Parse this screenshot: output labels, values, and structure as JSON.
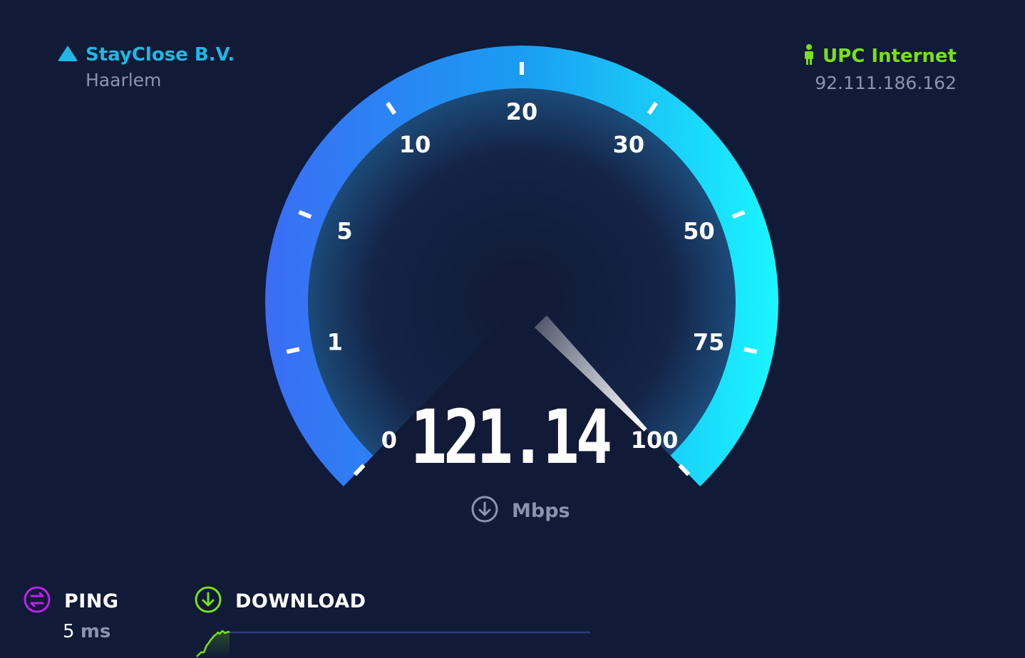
{
  "server": {
    "name": "StayClose B.V.",
    "location": "Haarlem",
    "icon": "triangle-icon",
    "color": "#1fb8e6"
  },
  "isp": {
    "name": "UPC Internet",
    "ip": "92.111.186.162",
    "icon": "person-icon",
    "color": "#7be016"
  },
  "gauge": {
    "value": "121.14",
    "unit": "Mbps",
    "scale_labels": [
      "0",
      "1",
      "5",
      "10",
      "20",
      "30",
      "50",
      "75",
      "100"
    ],
    "needle_fraction": 1.0,
    "gradient_start": "#3a6df5",
    "gradient_end": "#19f2ff"
  },
  "ping": {
    "label": "PING",
    "value": "5",
    "unit": "ms",
    "color": "#c021f0"
  },
  "download": {
    "label": "DOWNLOAD",
    "color": "#7be016"
  }
}
